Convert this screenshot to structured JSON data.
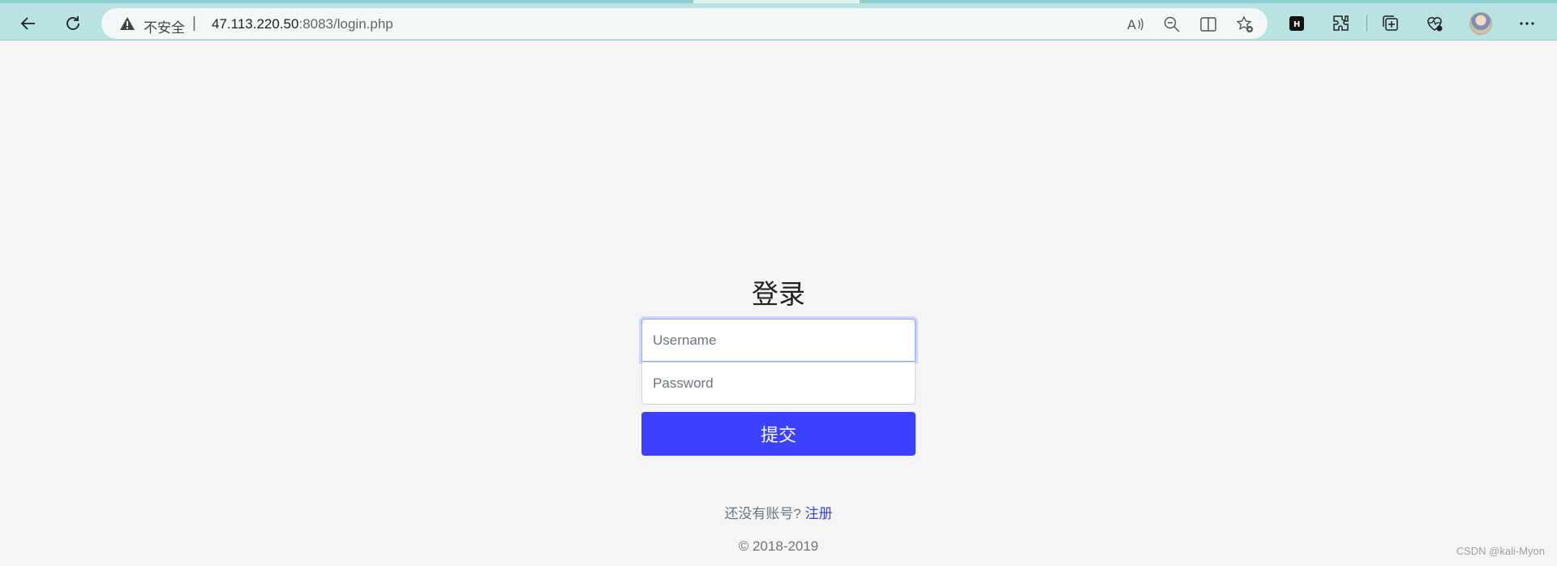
{
  "browser": {
    "security_label": "不安全",
    "separator": "|",
    "url_host": "47.113.220.50",
    "url_rest": ":8083/login.php",
    "icons": [
      "back-icon",
      "refresh-icon",
      "warning-icon",
      "read-aloud-icon",
      "zoom-out-icon",
      "split-screen-icon",
      "favorite-add-icon",
      "extension-h-icon",
      "extensions-icon",
      "collections-icon",
      "browser-essentials-icon",
      "profile-avatar",
      "more-icon"
    ],
    "colors": {
      "chrome_bg": "#b9e3e2",
      "addr_bg": "#f3f7f7"
    }
  },
  "login": {
    "title": "登录",
    "username_placeholder": "Username",
    "password_placeholder": "Password",
    "submit_label": "提交",
    "register_prompt": "还没有账号?",
    "register_link": "注册",
    "copyright": "© 2018-2019",
    "colors": {
      "primary": "#3b41ff",
      "page_bg": "#f5f5f5"
    }
  },
  "watermark": "CSDN @kali-Myon"
}
